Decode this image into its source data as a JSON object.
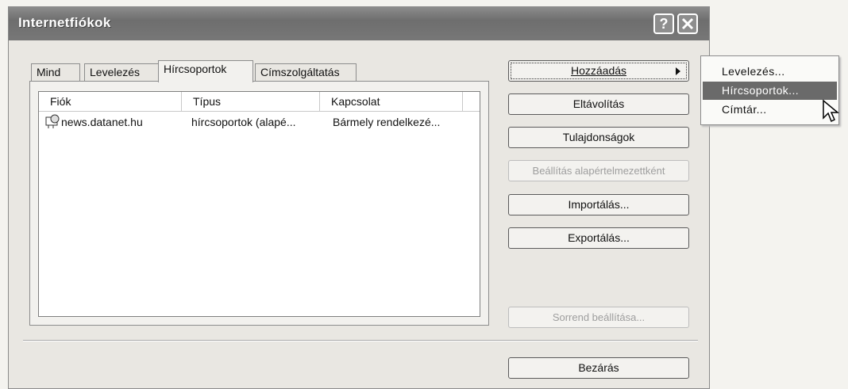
{
  "window": {
    "title": "Internetfiókok"
  },
  "tabs": [
    {
      "label": "Mind"
    },
    {
      "label": "Levelezés"
    },
    {
      "label": "Hírcsoportok"
    },
    {
      "label": "Címszolgáltatás"
    }
  ],
  "list": {
    "headers": [
      "Fiók",
      "Típus",
      "Kapcsolat"
    ],
    "rows": [
      {
        "account": "news.datanet.hu",
        "type": "hírcsoportok (alapé...",
        "connection": "Bármely rendelkezé...",
        "icon": "newsgroup-icon"
      }
    ]
  },
  "buttons": {
    "add": "Hozzáadás",
    "remove": "Eltávolítás",
    "properties": "Tulajdonságok",
    "set_default": "Beállítás alapértelmezettként",
    "import": "Importálás...",
    "export": "Exportálás...",
    "set_order": "Sorrend beállítása...",
    "close": "Bezárás"
  },
  "add_menu": {
    "items": [
      {
        "label": "Levelezés..."
      },
      {
        "label": "Hírcsoportok..."
      },
      {
        "label": "Címtár..."
      }
    ]
  }
}
